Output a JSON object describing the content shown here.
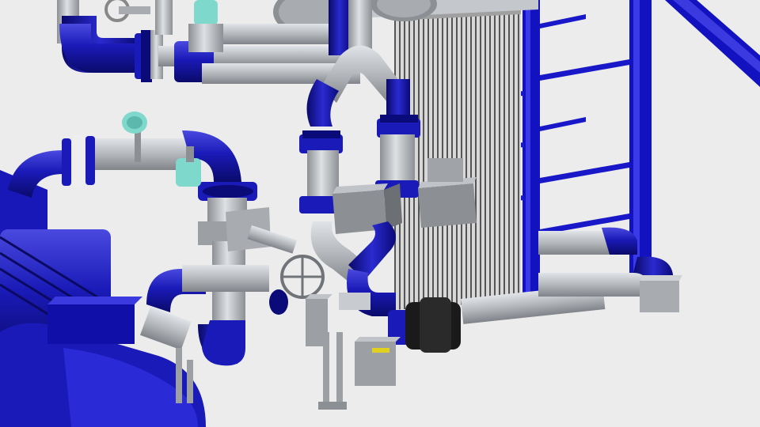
{
  "scene": {
    "background": "#ececec",
    "colors": {
      "pipe_blue": "#1a1ab8",
      "pipe_blue_dark": "#0a0a78",
      "pipe_blue_light": "#4a4ae0",
      "pipe_grey": "#b4b8bc",
      "pipe_grey_light": "#d4d8dc",
      "pipe_grey_dark": "#8c9094",
      "gauge_teal": "#7fd8cc",
      "accent_yellow": "#e0d020",
      "frame_blue": "#1212c0",
      "plate_dark": "#5a5a5a",
      "actuator_black": "#1a1a1a"
    }
  }
}
